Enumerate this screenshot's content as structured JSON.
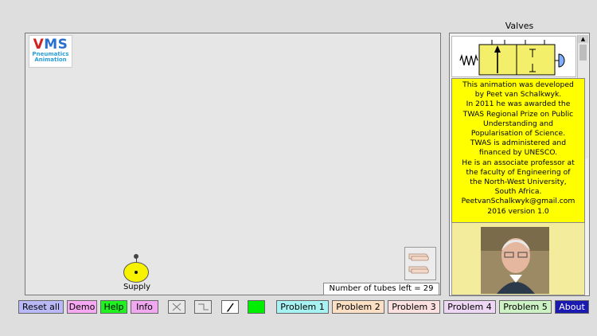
{
  "logo": {
    "big_v": "V",
    "big_ms": "MS",
    "line1": "Pneumatics",
    "line2": "Animation"
  },
  "supply": {
    "label": "Supply"
  },
  "status": {
    "tubes_left": "Number of tubes left = 29"
  },
  "valves": {
    "title": "Valves"
  },
  "about": {
    "lines": [
      "This animation was developed",
      "by Peet van Schalkwyk.",
      "In 2011 he was awarded the",
      "TWAS Regional Prize on Public",
      "Understanding and",
      "Popularisation of Science.",
      "TWAS is administered and",
      "financed by UNESCO.",
      "He is an associate professor at",
      "the faculty of Engineering of",
      "the North-West University,",
      "South Africa.",
      "PeetvanSchalkwyk@gmail.com",
      "2016 version 1.0"
    ]
  },
  "toolbar": {
    "reset_all": "Reset all",
    "demo": "Demo",
    "help": "Help",
    "info": "Info",
    "problem1": "Problem 1",
    "problem2": "Problem 2",
    "problem3": "Problem 3",
    "problem4": "Problem 4",
    "problem5": "Problem 5",
    "about": "About"
  },
  "colors": {
    "reset_all": "#b9b9f7",
    "demo": "#f6a8f2",
    "help": "#1ff21f",
    "info": "#f0a8f0",
    "color_swatch": "#00ee00",
    "problem1": "#a7f3f3",
    "problem2": "#fde0c4",
    "problem3": "#fde0e0",
    "problem4": "#eed7f4",
    "problem5": "#cdf2c4",
    "about": "#1a1ab0",
    "about_text": "#ffffff"
  },
  "icons": [
    "cross-icon",
    "elbow-tube-icon",
    "pencil-icon",
    "color-swatch-icon",
    "hand-icon",
    "spring-icon",
    "pushbutton-icon"
  ]
}
